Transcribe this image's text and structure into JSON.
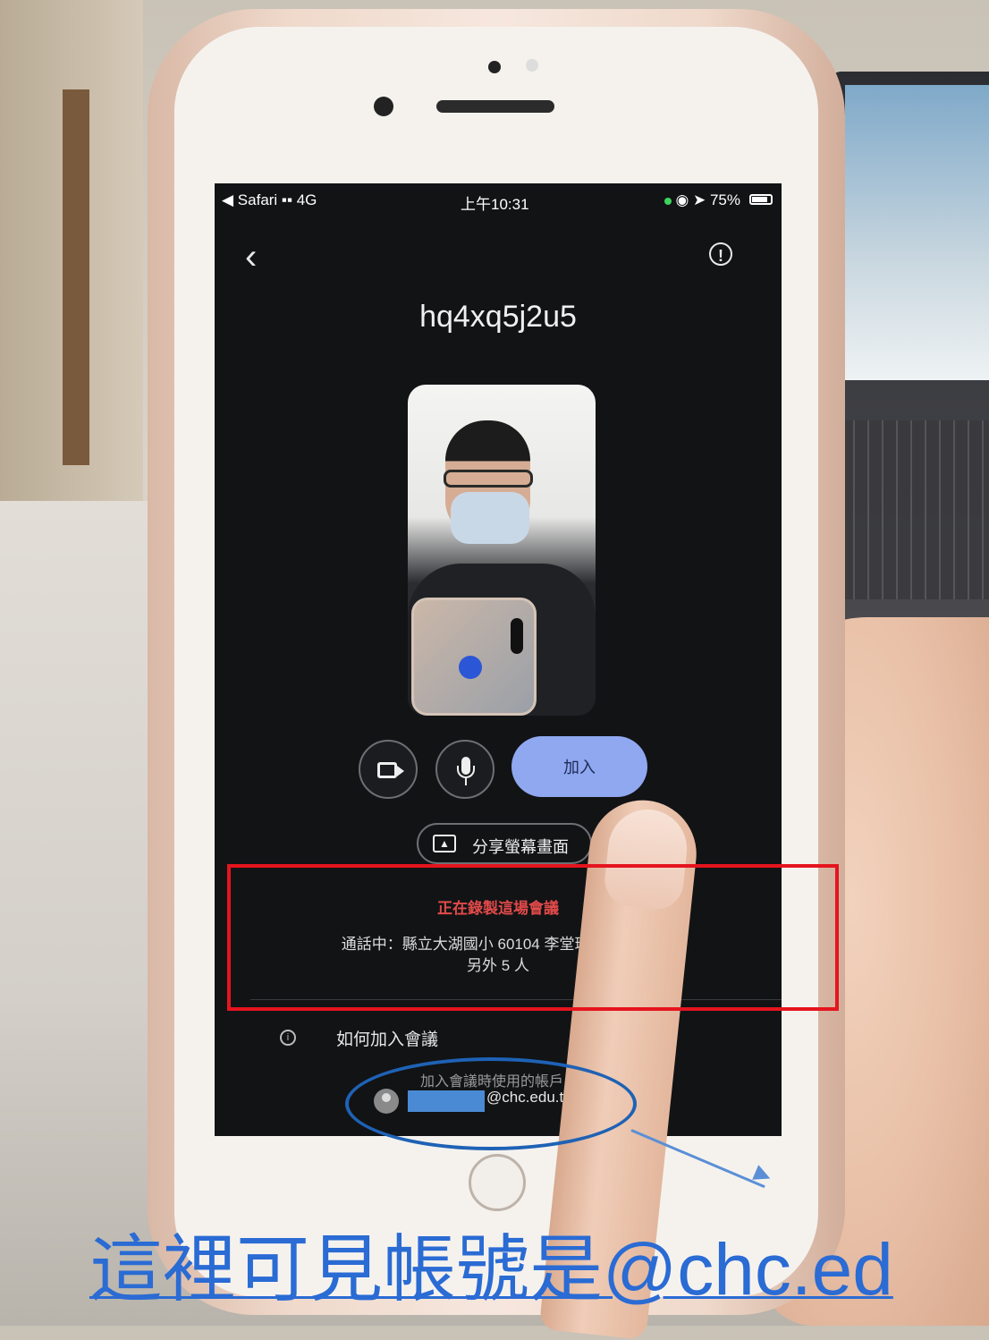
{
  "status_bar": {
    "carrier": "◀ Safari ▪▪ 4G",
    "time": "上午10:31",
    "battery": "◉ ➤ 75%"
  },
  "meeting": {
    "code": "hq4xq5j2u5",
    "join_label": "加入",
    "share_screen_label": "分享螢幕畫面",
    "recording_notice": "正在錄製這場會議",
    "participants_line1": "通話中：縣立大湖國小 60104 李堂瑋、縣 惠和",
    "participants_line2": "另外 5 人",
    "how_to_join_label": "如何加入會議",
    "account_caption": "加入會議時使用的帳戶",
    "account_email": "@chc.edu.tw"
  },
  "icons": {
    "back": "chevron-left-icon",
    "report": "report-problem-icon",
    "camera": "camera-icon",
    "mic": "mic-icon",
    "share": "present-screen-icon",
    "info": "info-icon",
    "avatar": "account-avatar-icon"
  },
  "colors": {
    "join_button": "#8fa8f0",
    "recording_text": "#e24a4a",
    "annotation_box": "#e5141e",
    "annotation_ellipse": "#1e62b5",
    "caption": "#2a6bd4"
  },
  "annotation": {
    "caption": "這裡可見帳號是@chc.ed"
  }
}
